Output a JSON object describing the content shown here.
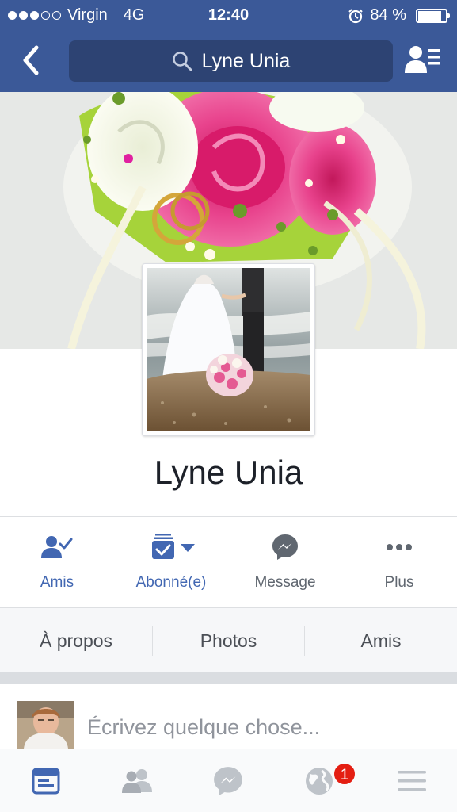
{
  "status_bar": {
    "carrier": "Virgin",
    "network": "4G",
    "time": "12:40",
    "battery_text": "84 %",
    "battery_level": 0.84,
    "signal_bars": 3
  },
  "nav": {
    "back_icon": "chevron-left-icon",
    "search_text": "Lyne Unia",
    "friend_requests_icon": "friend-requests-icon"
  },
  "profile": {
    "name": "Lyne Unia"
  },
  "actions": [
    {
      "label": "Amis",
      "icon": "friends-check-icon"
    },
    {
      "label": "Abonné(e)",
      "icon": "subscribed-icon"
    },
    {
      "label": "Message",
      "icon": "messenger-icon"
    },
    {
      "label": "Plus",
      "icon": "more-icon"
    }
  ],
  "tabs": [
    {
      "label": "À propos"
    },
    {
      "label": "Photos"
    },
    {
      "label": "Amis"
    }
  ],
  "composer": {
    "placeholder": "Écrivez quelque chose..."
  },
  "tabbar": {
    "items": [
      "news-feed-icon",
      "friends-icon",
      "messenger-icon",
      "notifications-globe-icon",
      "menu-icon"
    ],
    "notification_badge": "1"
  },
  "colors": {
    "brand": "#3b5998",
    "action_blue": "#4267b2",
    "badge_red": "#e41e12"
  }
}
